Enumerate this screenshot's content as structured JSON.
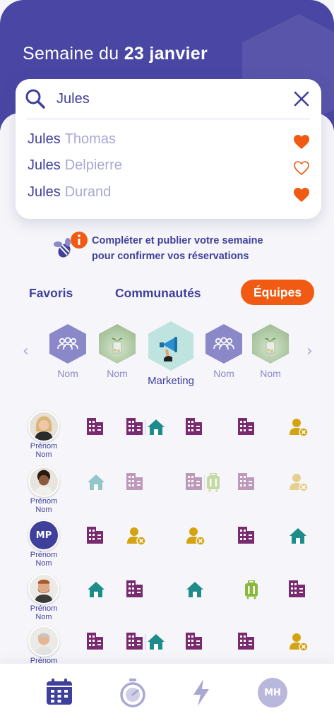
{
  "header": {
    "title_prefix": "Semaine du",
    "title_date": "23 janvier"
  },
  "search": {
    "value": "Jules",
    "placeholder": "",
    "results": [
      {
        "first": "Jules",
        "last": "Thomas",
        "favorite": true
      },
      {
        "first": "Jules",
        "last": "Delpierre",
        "favorite": false
      },
      {
        "first": "Jules",
        "last": "Durand",
        "favorite": true
      }
    ]
  },
  "notice": {
    "line1": "Compléter et publier votre semaine",
    "line2": "pour confirmer vos réservations"
  },
  "tabs": [
    {
      "label": "Favoris",
      "active": false
    },
    {
      "label": "Communautés",
      "active": false
    },
    {
      "label": "Équipes",
      "active": true
    }
  ],
  "teams": [
    {
      "name": "Nom",
      "icon": "people-icon"
    },
    {
      "name": "Nom",
      "icon": "plant-photo"
    },
    {
      "name": "Marketing",
      "icon": "megaphone-icon",
      "selected": true
    },
    {
      "name": "Nom",
      "icon": "people-icon"
    },
    {
      "name": "Nom",
      "icon": "plant-photo"
    }
  ],
  "people": [
    {
      "first": "Prénom",
      "last": "Nom",
      "avatar": "photo-woman",
      "days": [
        "office",
        "office+home",
        "office",
        "office",
        "absent"
      ],
      "faded": [
        false,
        false,
        false,
        false,
        false
      ]
    },
    {
      "first": "Prénom",
      "last": "Nom",
      "avatar": "photo-man",
      "days": [
        "home",
        "office",
        "office+travel",
        "office",
        "absent"
      ],
      "faded": [
        true,
        true,
        true,
        true,
        true
      ]
    },
    {
      "first": "Prénom",
      "last": "Nom",
      "avatar": "MP",
      "days": [
        "office",
        "absent",
        "absent",
        "office",
        "home"
      ],
      "faded": [
        false,
        false,
        false,
        false,
        false
      ]
    },
    {
      "first": "Prénom",
      "last": "Nom",
      "avatar": "photo-man-beard",
      "days": [
        "home",
        "office",
        "home",
        "travel",
        "office"
      ],
      "faded": [
        false,
        false,
        false,
        false,
        false
      ]
    },
    {
      "first": "Prénom",
      "last": "Nom",
      "avatar": "photo-man-grey",
      "days": [
        "office",
        "office+home",
        "office",
        "office",
        "absent"
      ],
      "faded": [
        false,
        false,
        false,
        false,
        false
      ]
    }
  ],
  "colors": {
    "primary": "#3f3f9c",
    "accent": "#f05a12",
    "office": "#7a2a6e",
    "home": "#1f8c8c",
    "absent": "#d4a310",
    "travel": "#8ab83a"
  },
  "bottom_nav": {
    "items": [
      "calendar-icon",
      "stopwatch-icon",
      "lightning-icon"
    ],
    "user_initials": "MH"
  }
}
